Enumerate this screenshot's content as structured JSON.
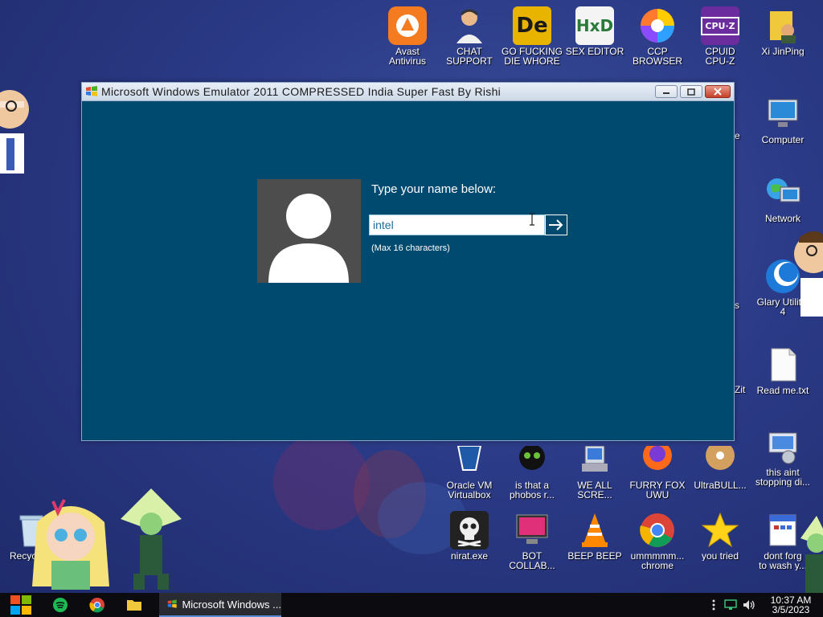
{
  "window": {
    "title": "Microsoft Windows Emulator 2011 COMPRESSED India Super Fast By Rishi",
    "prompt": "Type your name below:",
    "name_value": "intel",
    "max_note": "(Max 16 characters)"
  },
  "desktop_icons": {
    "avast": "Avast\nAntivirus",
    "chat": "CHAT\nSUPPORT",
    "gofck": "GO FUCKING\nDIE WHORE",
    "sexeditor": "SEX EDITOR",
    "ccp": "CCP\nBROWSER",
    "cpuz": "CPUID\nCPU-Z",
    "xi": "Xi JinPing",
    "computer": "Computer",
    "network": "Network",
    "glary": "Glary Utilitie\n4",
    "readme": "Read me.txt",
    "oracle": "Oracle VM\nVirtualbox",
    "phobos": "is that a\nphobos r...",
    "weall": "WE ALL\nSCRE...",
    "furry": "FURRY FOX\nUWU",
    "ultrabull": "UltraBULL...",
    "thisaint": "this aint\nstopping di...",
    "recycle": "Recycle B",
    "nirat": "nirat.exe",
    "bot": "BOT\nCOLLAB...",
    "beep": "BEEP BEEP",
    "ummm": "ummmmm...\nchrome",
    "youtried": "you tried",
    "dontforget": "dont forg\nto wash y..."
  },
  "partial_labels": {
    "e": "e",
    "s": "s",
    "zit": "Zit"
  },
  "taskbar": {
    "task_label": "Microsoft Windows ...",
    "time": "10:37 AM",
    "date": "3/5/2023"
  },
  "colors": {
    "window_bg": "#00496f",
    "taskbar_bg": "#0c0c10",
    "desktop_bg": "#2b3a86"
  }
}
